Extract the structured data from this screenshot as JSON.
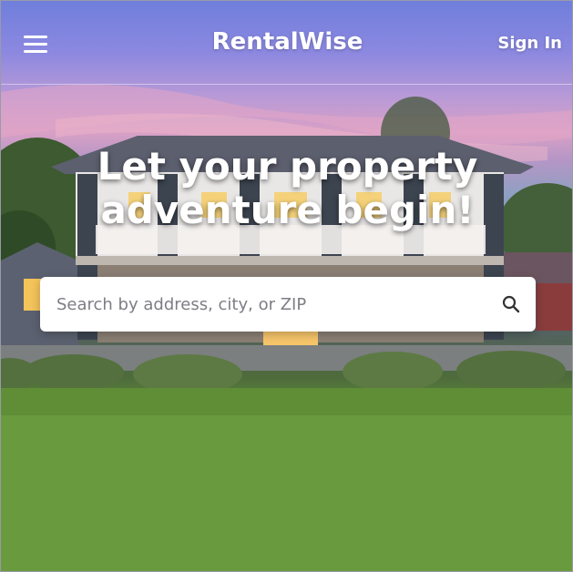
{
  "header": {
    "menu_icon": "hamburger-menu-icon",
    "brand": "RentalWise",
    "sign_in_label": "Sign In"
  },
  "hero": {
    "headline": "Let your property adventure begin!",
    "background": "photo of two-story house at dusk with lawn"
  },
  "search": {
    "placeholder": "Search by address, city, or ZIP",
    "value": "",
    "button_icon": "search-icon"
  },
  "colors": {
    "text_on_image": "#ffffff",
    "search_bg": "#ffffff",
    "placeholder": "#7d7d85",
    "lawn": "#6a9a3e",
    "sky": "#8c88e0"
  }
}
